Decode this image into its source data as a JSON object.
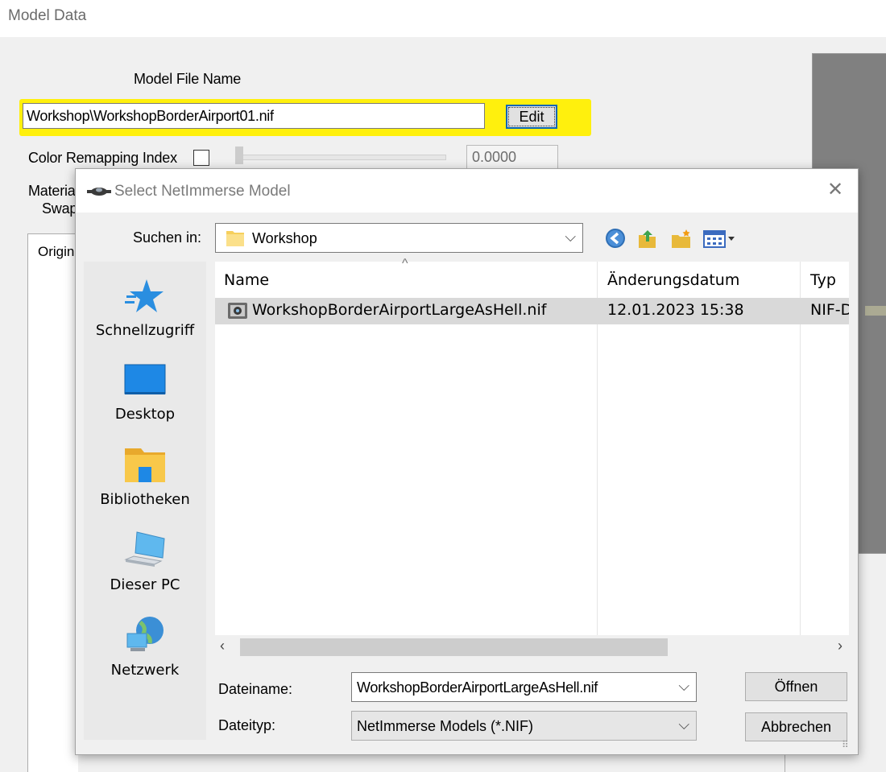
{
  "window": {
    "title": "Model Data",
    "model_file_label": "Model File Name",
    "model_file_value": "Workshop\\WorkshopBorderAirport01.nif",
    "edit_label": "Edit",
    "color_remap_label": "Color Remapping Index",
    "color_remap_checked": false,
    "color_remap_value": "0.0000",
    "material_label_line1": "Materia",
    "material_label_line2": "Swap",
    "tab_original": "Origin"
  },
  "dialog": {
    "title": "Select NetImmerse Model",
    "look_in_label": "Suchen in:",
    "look_in_value": "Workshop",
    "places": [
      {
        "label": "Schnellzugriff",
        "icon": "star-icon"
      },
      {
        "label": "Desktop",
        "icon": "desktop-icon"
      },
      {
        "label": "Bibliotheken",
        "icon": "libraries-icon"
      },
      {
        "label": "Dieser PC",
        "icon": "computer-icon"
      },
      {
        "label": "Netzwerk",
        "icon": "network-icon"
      }
    ],
    "columns": {
      "name": "Name",
      "date": "Änderungsdatum",
      "type": "Typ"
    },
    "files": [
      {
        "name": "WorkshopBorderAirportLargeAsHell.nif",
        "date": "12.01.2023 15:38",
        "type": "NIF-D"
      }
    ],
    "filename_label": "Dateiname:",
    "filename_value": "WorkshopBorderAirportLargeAsHell.nif",
    "filetype_label": "Dateityp:",
    "filetype_value": "NetImmerse Models (*.NIF)",
    "open_label": "Öffnen",
    "cancel_label": "Abbrechen"
  },
  "colors": {
    "highlight": "#ffef00",
    "selected_row": "#d9d9d9",
    "preview_panel": "#808080"
  }
}
